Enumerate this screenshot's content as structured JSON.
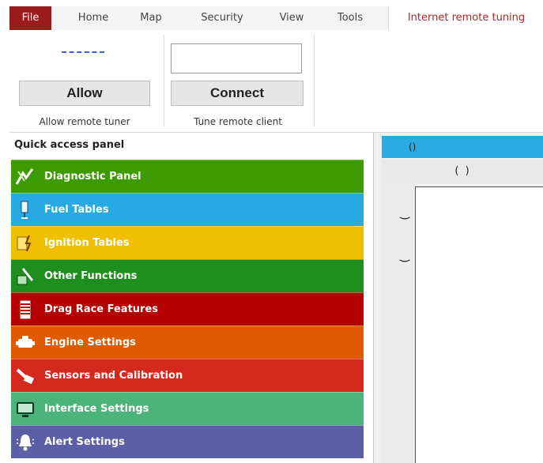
{
  "menu": {
    "tabs": [
      {
        "label": "File"
      },
      {
        "label": "Home"
      },
      {
        "label": "Map"
      },
      {
        "label": "Security"
      },
      {
        "label": "View"
      },
      {
        "label": "Tools"
      },
      {
        "label": "Internet remote tuning"
      }
    ],
    "active_tab": "Internet remote tuning"
  },
  "ribbon": {
    "allow_group": {
      "status": "------",
      "button_label": "Allow",
      "group_label": "Allow remote tuner"
    },
    "connect_group": {
      "input_value": "",
      "button_label": "Connect",
      "group_label": "Tune remote client"
    }
  },
  "quick_access": {
    "title": "Quick access panel",
    "items": [
      {
        "label": "Diagnostic Panel",
        "color": "#3d9b00",
        "icon": "diagnostic-icon"
      },
      {
        "label": "Fuel Tables",
        "color": "#27a9e1",
        "icon": "fuel-injector-icon"
      },
      {
        "label": "Ignition Tables",
        "color": "#f0c000",
        "icon": "ignition-icon"
      },
      {
        "label": "Other Functions",
        "color": "#1e8f1e",
        "icon": "other-functions-icon"
      },
      {
        "label": "Drag Race Features",
        "color": "#b40000",
        "icon": "drag-race-icon"
      },
      {
        "label": "Engine Settings",
        "color": "#e05a00",
        "icon": "engine-icon"
      },
      {
        "label": "Sensors and Calibration",
        "color": "#d42a1e",
        "icon": "sensor-icon"
      },
      {
        "label": "Interface Settings",
        "color": "#4cb37a",
        "icon": "monitor-icon"
      },
      {
        "label": "Alert Settings",
        "color": "#5a5fa6",
        "icon": "bell-icon"
      }
    ]
  },
  "right_pane": {
    "header": "()",
    "subheader": "( )",
    "left_marks": [
      ")",
      ")"
    ]
  }
}
